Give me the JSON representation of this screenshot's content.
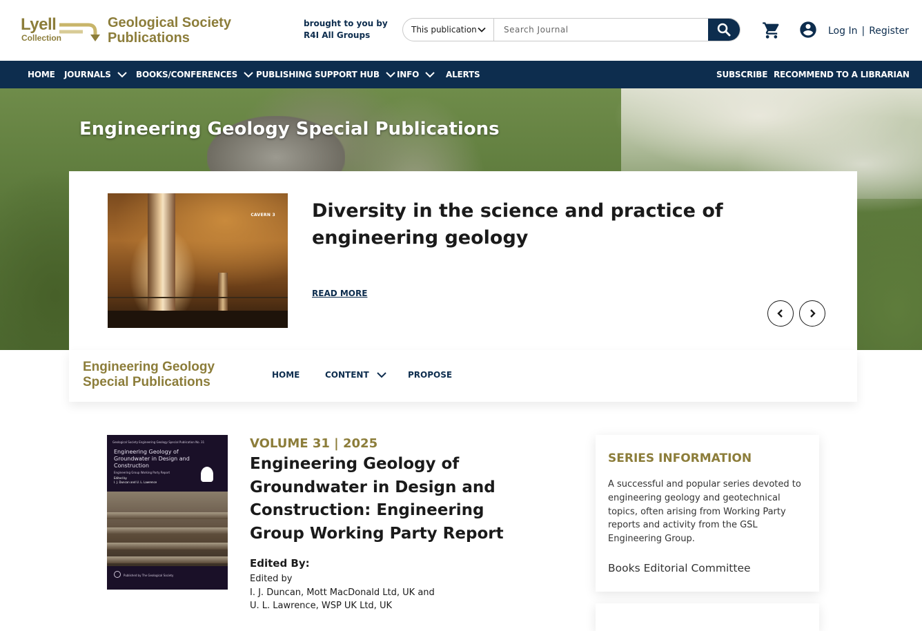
{
  "header": {
    "logo": {
      "lyell": "Lyell",
      "collection": "Collection",
      "gsp_line1": "Geological Society",
      "gsp_line2": "Publications"
    },
    "brought_by_line1": "brought to you by",
    "brought_by_line2": "R4I All Groups",
    "search": {
      "scope": "This publication",
      "placeholder": "Search Journal"
    },
    "auth": {
      "login": "Log In",
      "separator": "|",
      "register": "Register"
    }
  },
  "nav": {
    "items": [
      {
        "label": "HOME"
      },
      {
        "label": "JOURNALS"
      },
      {
        "label": "BOOKS/CONFERENCES"
      },
      {
        "label": "PUBLISHING SUPPORT HUB"
      },
      {
        "label": "INFO"
      },
      {
        "label": "ALERTS"
      }
    ],
    "right": [
      {
        "label": "SUBSCRIBE"
      },
      {
        "label": "RECOMMEND TO A LIBRARIAN"
      }
    ]
  },
  "hero": {
    "title": "Engineering Geology Special Publications",
    "feature": {
      "image_tag": "CAVERN 3",
      "title": "Diversity in the science and practice of engineering geology",
      "read_more": "READ MORE"
    }
  },
  "subnav": {
    "logo_line1": "Engineering Geology",
    "logo_line2": "Special Publications",
    "items": [
      {
        "label": "HOME"
      },
      {
        "label": "CONTENT"
      },
      {
        "label": "PROPOSE"
      }
    ]
  },
  "volume": {
    "label": "VOLUME 31 | 2025",
    "title": "Engineering Geology of Groundwater in Design and Construction: Engineering Group Working Party Report",
    "edited_by_heading": "Edited By:",
    "edited_lines": [
      "Edited by",
      "I. J. Duncan, Mott MacDonald Ltd, UK and",
      "U. L. Lawrence, WSP UK Ltd, UK"
    ],
    "cover": {
      "series_line": "Geological Society Engineering Geology Special Publication No. 31",
      "title": "Engineering Geology of Groundwater in Design and Construction",
      "subtitle": "Engineering Group Working Party Report",
      "edited_label": "Edited by",
      "editors": "I. J. Duncan and U. L. Lawrence",
      "publisher": "Published by The Geological Society"
    }
  },
  "series_info": {
    "heading": "SERIES INFORMATION",
    "description": "A successful and popular series devoted to engineering geology and geotechnical topics, often arising from Working Party reports and activity from the GSL Engineering Group.",
    "link": "Books Editorial Committee"
  },
  "colors": {
    "navy": "#0d2d4e",
    "gold": "#8c7d3a"
  }
}
